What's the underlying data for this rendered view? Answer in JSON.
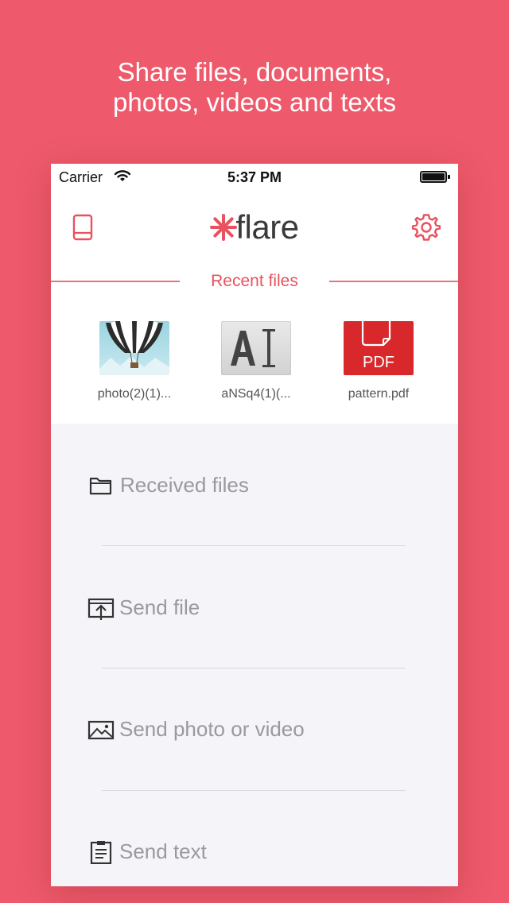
{
  "headline": {
    "line1": "Share files, documents,",
    "line2": "photos, videos and texts"
  },
  "colors": {
    "background": "#ee5a6b",
    "accent": "#e8525f",
    "pdf_red": "#d8282b"
  },
  "status_bar": {
    "carrier": "Carrier",
    "time": "5:37 PM",
    "icons": [
      "wifi-icon",
      "battery-icon"
    ]
  },
  "nav": {
    "left_icon": "tablet-icon",
    "logo_text": "flare",
    "logo_mark": "asterisk-icon",
    "right_icon": "gear-icon"
  },
  "recent": {
    "title": "Recent files",
    "files": [
      {
        "name": "photo(2)(1)...",
        "thumb": "balloon-photo-thumbnail"
      },
      {
        "name": "aNSq4(1)(...",
        "thumb": "text-cursor-thumbnail"
      },
      {
        "name": "pattern.pdf",
        "thumb": "pdf-thumbnail",
        "badge": "PDF"
      }
    ]
  },
  "menu": [
    {
      "label": "Received files",
      "icon": "folder-icon"
    },
    {
      "label": "Send file",
      "icon": "upload-icon"
    },
    {
      "label": "Send photo or video",
      "icon": "image-icon"
    },
    {
      "label": "Send text",
      "icon": "clipboard-icon"
    }
  ]
}
